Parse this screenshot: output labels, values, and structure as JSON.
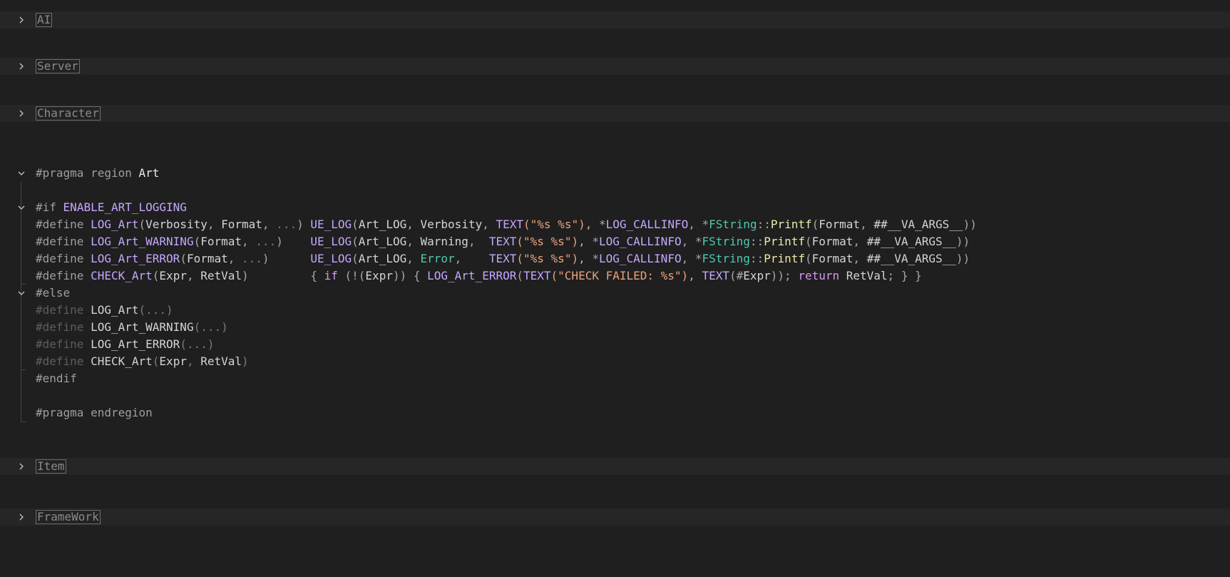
{
  "folded_regions": {
    "ai": "AI",
    "server": "Server",
    "character": "Character",
    "item": "Item",
    "framework": "FrameWork"
  },
  "icons": {
    "collapsed": "chevron-right-icon",
    "expanded": "chevron-down-icon"
  },
  "code": {
    "region_start": {
      "kw": "#pragma region",
      "name": "Art"
    },
    "if_line": {
      "kw": "#if",
      "macro": "ENABLE_ART_LOGGING"
    },
    "define_kw": "#define",
    "else_kw": "#else",
    "endif_kw": "#endif",
    "region_end": "#pragma endregion",
    "def1": {
      "name": "LOG_Art",
      "p_open": "(",
      "a1": "Verbosity",
      "c1": ", ",
      "a2": "Format",
      "c2": ", ",
      "ell": "...",
      "p_close": ")",
      "gap": " ",
      "uelog": "UE_LOG",
      "o1": "(",
      "cat": "Art_LOG",
      "s1": ", ",
      "verb": "Verbosity",
      "s2": ", ",
      "text": "TEXT",
      "o2": "(\"",
      "fmt": "%s %s",
      "cl2": "\"), ",
      "star1": "*",
      "callinfo": "LOG_CALLINFO",
      "s3": ", ",
      "star2": "*",
      "fstring": "FString",
      "dc": "::",
      "printf": "Printf",
      "o3": "(",
      "format": "Format",
      "s4": ", ",
      "va": "##__VA_ARGS__",
      "end": "))"
    },
    "def2": {
      "name": "LOG_Art_WARNING",
      "p_open": "(",
      "a1": "Format",
      "c1": ", ",
      "ell": "...",
      "p_close": ")",
      "gap": "    ",
      "uelog": "UE_LOG",
      "o1": "(",
      "cat": "Art_LOG",
      "s1": ", ",
      "verb": "Warning",
      "s2": ",  ",
      "text": "TEXT",
      "o2": "(\"",
      "fmt": "%s %s",
      "cl2": "\"), ",
      "star1": "*",
      "callinfo": "LOG_CALLINFO",
      "s3": ", ",
      "star2": "*",
      "fstring": "FString",
      "dc": "::",
      "printf": "Printf",
      "o3": "(",
      "format": "Format",
      "s4": ", ",
      "va": "##__VA_ARGS__",
      "end": "))"
    },
    "def3": {
      "name": "LOG_Art_ERROR",
      "p_open": "(",
      "a1": "Format",
      "c1": ", ",
      "ell": "...",
      "p_close": ")",
      "gap": "      ",
      "uelog": "UE_LOG",
      "o1": "(",
      "cat": "Art_LOG",
      "s1": ", ",
      "verb": "Error",
      "s2": ",    ",
      "text": "TEXT",
      "o2": "(\"",
      "fmt": "%s %s",
      "cl2": "\"), ",
      "star1": "*",
      "callinfo": "LOG_CALLINFO",
      "s3": ", ",
      "star2": "*",
      "fstring": "FString",
      "dc": "::",
      "printf": "Printf",
      "o3": "(",
      "format": "Format",
      "s4": ", ",
      "va": "##__VA_ARGS__",
      "end": "))"
    },
    "def4": {
      "name": "CHECK_Art",
      "p_open": "(",
      "a1": "Expr",
      "c1": ", ",
      "a2": "RetVal",
      "p_close": ")",
      "gap": "         ",
      "brace_open": "{ ",
      "if_kw": "if",
      "cond_open": " (!(",
      "expr": "Expr",
      "cond_close": ")) { ",
      "err_macro": "LOG_Art_ERROR",
      "o1": "(",
      "text": "TEXT",
      "o2": "(\"",
      "msg": "CHECK FAILED: ",
      "fmt": "%s",
      "cl2": "\"), ",
      "text2": "TEXT",
      "o3": "(#",
      "expr2": "Expr",
      "cl3": ")); ",
      "ret_kw": "return",
      "retval": " RetVal",
      "end": "; } }"
    },
    "else1": {
      "name": "LOG_Art",
      "args": "(...)"
    },
    "else2": {
      "name": "LOG_Art_WARNING",
      "args": "(...)"
    },
    "else3": {
      "name": "LOG_Art_ERROR",
      "args": "(...)"
    },
    "else4": {
      "name": "CHECK_Art",
      "p_open": "(",
      "a1": "Expr",
      "c1": ", ",
      "a2": "RetVal",
      "p_close": ")"
    }
  }
}
